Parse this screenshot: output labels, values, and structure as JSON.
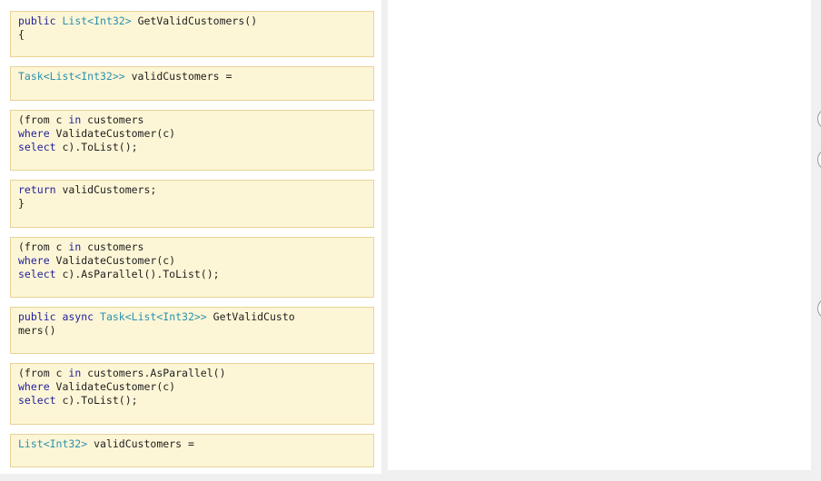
{
  "colors": {
    "keyword": "#1f1f9a",
    "type": "#2b91af",
    "text": "#1e1e1e",
    "snippet_bg": "#fdf6d6",
    "snippet_border": "#e7d396"
  },
  "snippets": [
    {
      "lines": [
        [
          {
            "t": "public",
            "c": "kw"
          },
          {
            "t": " ",
            "c": "tx"
          },
          {
            "t": "List<Int32>",
            "c": "ty"
          },
          {
            "t": " GetValidCustomers()",
            "c": "tx"
          }
        ],
        [
          {
            "t": "{",
            "c": "tx"
          }
        ]
      ]
    },
    {
      "lines": [
        [
          {
            "t": "Task<List<Int32>>",
            "c": "ty"
          },
          {
            "t": " validCustomers =",
            "c": "tx"
          }
        ]
      ]
    },
    {
      "lines": [
        [
          {
            "t": "(from c ",
            "c": "tx"
          },
          {
            "t": "in",
            "c": "kw"
          },
          {
            "t": " customers",
            "c": "tx"
          }
        ],
        [
          {
            "t": "where",
            "c": "kw"
          },
          {
            "t": " ValidateCustomer(c)",
            "c": "tx"
          }
        ],
        [
          {
            "t": "select",
            "c": "kw"
          },
          {
            "t": " c).ToList();",
            "c": "tx"
          }
        ]
      ]
    },
    {
      "lines": [
        [
          {
            "t": "return",
            "c": "kw"
          },
          {
            "t": " validCustomers;",
            "c": "tx"
          }
        ],
        [
          {
            "t": "}",
            "c": "tx"
          }
        ]
      ]
    },
    {
      "lines": [
        [
          {
            "t": "(from c ",
            "c": "tx"
          },
          {
            "t": "in",
            "c": "kw"
          },
          {
            "t": " customers",
            "c": "tx"
          }
        ],
        [
          {
            "t": "where",
            "c": "kw"
          },
          {
            "t": " ValidateCustomer(c)",
            "c": "tx"
          }
        ],
        [
          {
            "t": "select",
            "c": "kw"
          },
          {
            "t": " c).AsParallel().ToList();",
            "c": "tx"
          }
        ]
      ]
    },
    {
      "lines": [
        [
          {
            "t": "public async",
            "c": "kw"
          },
          {
            "t": " ",
            "c": "tx"
          },
          {
            "t": "Task<List<Int32>>",
            "c": "ty"
          },
          {
            "t": " GetValidCusto",
            "c": "tx"
          }
        ],
        [
          {
            "t": "mers()",
            "c": "tx"
          }
        ]
      ]
    },
    {
      "lines": [
        [
          {
            "t": "(from c ",
            "c": "tx"
          },
          {
            "t": "in",
            "c": "kw"
          },
          {
            "t": " customers.AsParallel()",
            "c": "tx"
          }
        ],
        [
          {
            "t": "where",
            "c": "kw"
          },
          {
            "t": " ValidateCustomer(c)",
            "c": "tx"
          }
        ],
        [
          {
            "t": "select",
            "c": "kw"
          },
          {
            "t": " c).ToList();",
            "c": "tx"
          }
        ]
      ]
    },
    {
      "lines": [
        [
          {
            "t": "List<Int32>",
            "c": "ty"
          },
          {
            "t": " validCustomers =",
            "c": "tx"
          }
        ]
      ]
    }
  ]
}
